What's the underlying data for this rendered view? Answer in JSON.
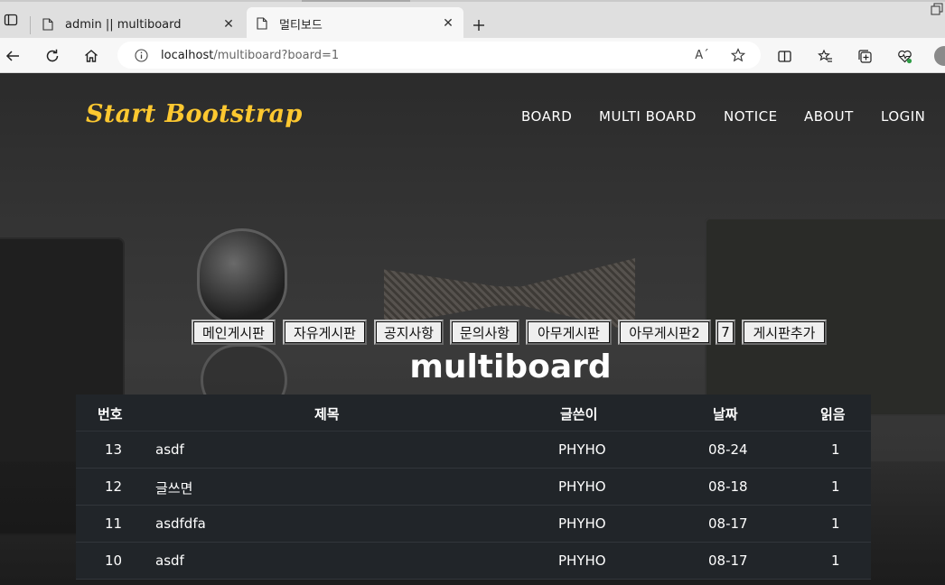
{
  "browser": {
    "tabs": [
      {
        "label": "admin || multiboard",
        "active": false
      },
      {
        "label": "멀티보드",
        "active": true
      }
    ],
    "url_host": "localhost",
    "url_path": "/multiboard?board=1",
    "read_aloud_icon": "A´"
  },
  "site": {
    "brand": "Start Bootstrap",
    "brand_color": "#fdc830",
    "nav": [
      "BOARD",
      "MULTI BOARD",
      "NOTICE",
      "ABOUT",
      "LOGIN"
    ]
  },
  "boards": [
    "메인게시판",
    "자유게시판",
    "공지사항",
    "문의사항",
    "아무게시판",
    "아무게시판2",
    "7",
    "게시판추가"
  ],
  "page_title": "multiboard",
  "table": {
    "headers": [
      "번호",
      "제목",
      "글쓴이",
      "날짜",
      "읽음"
    ],
    "rows": [
      {
        "no": "13",
        "title": "asdf",
        "author": "PHYHO",
        "date": "08-24",
        "views": "1"
      },
      {
        "no": "12",
        "title": "글쓰면",
        "author": "PHYHO",
        "date": "08-18",
        "views": "1"
      },
      {
        "no": "11",
        "title": "asdfdfa",
        "author": "PHYHO",
        "date": "08-17",
        "views": "1"
      },
      {
        "no": "10",
        "title": "asdf",
        "author": "PHYHO",
        "date": "08-17",
        "views": "1"
      }
    ]
  }
}
